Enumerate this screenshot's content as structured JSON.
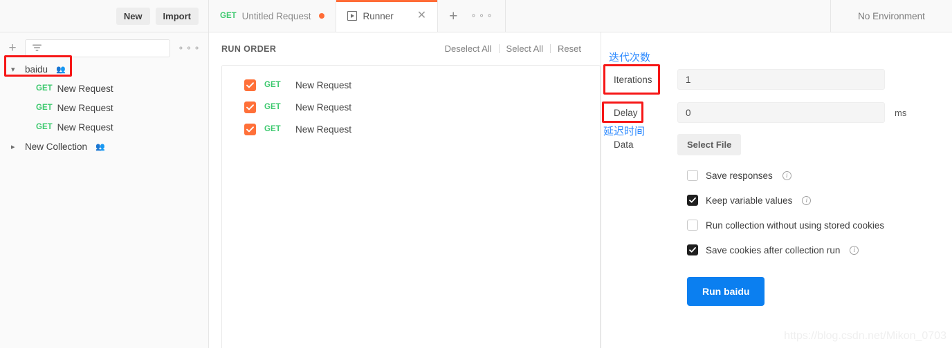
{
  "topbar": {
    "new_label": "New",
    "import_label": "Import",
    "environment_label": "No Environment",
    "add_tab_icon": "plus-icon",
    "more_tabs_icon": "ellipsis-icon",
    "tabs": [
      {
        "method": "GET",
        "label": "Untitled Request",
        "unsaved": true,
        "active": false
      },
      {
        "icon": "runner-play-icon",
        "label": "Runner",
        "active": true,
        "close_icon": "close-icon"
      }
    ]
  },
  "sidebar": {
    "add_icon": "plus-icon",
    "filter_icon": "filter-funnel-icon",
    "more_icon": "ellipsis-icon",
    "filter_placeholder": "",
    "collections": [
      {
        "name": "baidu",
        "expanded": true,
        "chevron": "chevron-down-icon",
        "shared_icon": "people-icon",
        "requests": [
          {
            "method": "GET",
            "name": "New Request"
          },
          {
            "method": "GET",
            "name": "New Request"
          },
          {
            "method": "GET",
            "name": "New Request"
          }
        ]
      },
      {
        "name": "New Collection",
        "expanded": false,
        "chevron": "chevron-right-icon",
        "shared_icon": "people-icon",
        "requests": []
      }
    ]
  },
  "run_order": {
    "title": "RUN ORDER",
    "actions": [
      {
        "label": "Deselect All"
      },
      {
        "label": "Select All"
      },
      {
        "label": "Reset"
      }
    ],
    "items": [
      {
        "checked": true,
        "method": "GET",
        "name": "New Request"
      },
      {
        "checked": true,
        "method": "GET",
        "name": "New Request"
      },
      {
        "checked": true,
        "method": "GET",
        "name": "New Request"
      }
    ]
  },
  "settings": {
    "iterations": {
      "label": "Iterations",
      "value": "1"
    },
    "delay": {
      "label": "Delay",
      "value": "0",
      "unit": "ms"
    },
    "data": {
      "label": "Data",
      "button_label": "Select File"
    },
    "options": [
      {
        "label": "Save responses",
        "checked": false,
        "info": true
      },
      {
        "label": "Keep variable values",
        "checked": true,
        "info": true
      },
      {
        "label": "Run collection without using stored cookies",
        "checked": false,
        "info": false
      },
      {
        "label": "Save cookies after collection run",
        "checked": true,
        "info": true
      }
    ],
    "run_button_label": "Run baidu"
  },
  "annotations": {
    "iterations_cn": "迭代次数",
    "delay_cn": "延迟时间"
  },
  "watermark": "https://blog.csdn.net/Mikon_0703",
  "colors": {
    "accent_orange": "#ff6c37",
    "method_green": "#3ec96f",
    "run_blue": "#0b7ff0",
    "annotation_red": "#f61717",
    "annotation_blue": "#2f8bff"
  }
}
